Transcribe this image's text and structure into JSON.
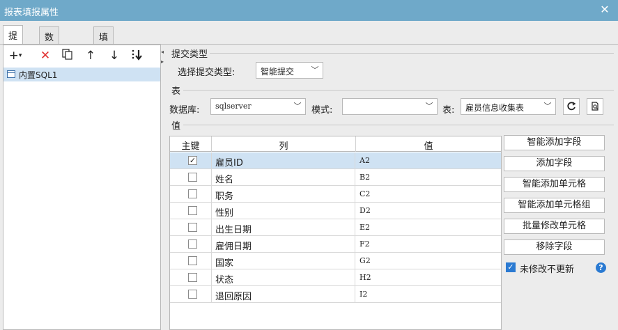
{
  "window": {
    "title": "报表填报属性",
    "close_icon": "close-icon"
  },
  "tabs": [
    {
      "label": "提交",
      "active": true
    },
    {
      "label": "数据校验",
      "active": false
    },
    {
      "label": "填报快捷键设置",
      "active": false
    }
  ],
  "toolbar": {
    "icons": [
      "add-icon",
      "delete-icon",
      "copy-icon",
      "move-up-icon",
      "move-down-icon",
      "sort-icon"
    ]
  },
  "tree": {
    "items": [
      {
        "label": "内置SQL1",
        "selected": true
      }
    ]
  },
  "submit_type": {
    "group_label": "提交类型",
    "label": "选择提交类型:",
    "value": "智能提交"
  },
  "table_section": {
    "group_label": "表",
    "db_label": "数据库:",
    "db_value": "sqlserver",
    "mode_label": "模式:",
    "mode_value": "",
    "table_label": "表:",
    "table_value": "雇员信息收集表"
  },
  "value_section": {
    "group_label": "值",
    "headers": {
      "key": "主键",
      "column": "列",
      "value": "值"
    },
    "rows": [
      {
        "key": true,
        "column": "雇员ID",
        "value": "A2",
        "selected": true
      },
      {
        "key": false,
        "column": "姓名",
        "value": "B2",
        "selected": false
      },
      {
        "key": false,
        "column": "职务",
        "value": "C2",
        "selected": false
      },
      {
        "key": false,
        "column": "性别",
        "value": "D2",
        "selected": false
      },
      {
        "key": false,
        "column": "出生日期",
        "value": "E2",
        "selected": false
      },
      {
        "key": false,
        "column": "雇佣日期",
        "value": "F2",
        "selected": false
      },
      {
        "key": false,
        "column": "国家",
        "value": "G2",
        "selected": false
      },
      {
        "key": false,
        "column": "状态",
        "value": "H2",
        "selected": false
      },
      {
        "key": false,
        "column": "退回原因",
        "value": "I2",
        "selected": false
      }
    ]
  },
  "buttons": [
    "智能添加字段",
    "添加字段",
    "智能添加单元格",
    "智能添加单元格组",
    "批量修改单元格",
    "移除字段"
  ],
  "no_update_unmodified": {
    "label": "未修改不更新",
    "checked": true
  },
  "colors": {
    "titlebar": "#6fa9c9",
    "selection": "#cfe2f3",
    "accent": "#2a7ad2"
  }
}
